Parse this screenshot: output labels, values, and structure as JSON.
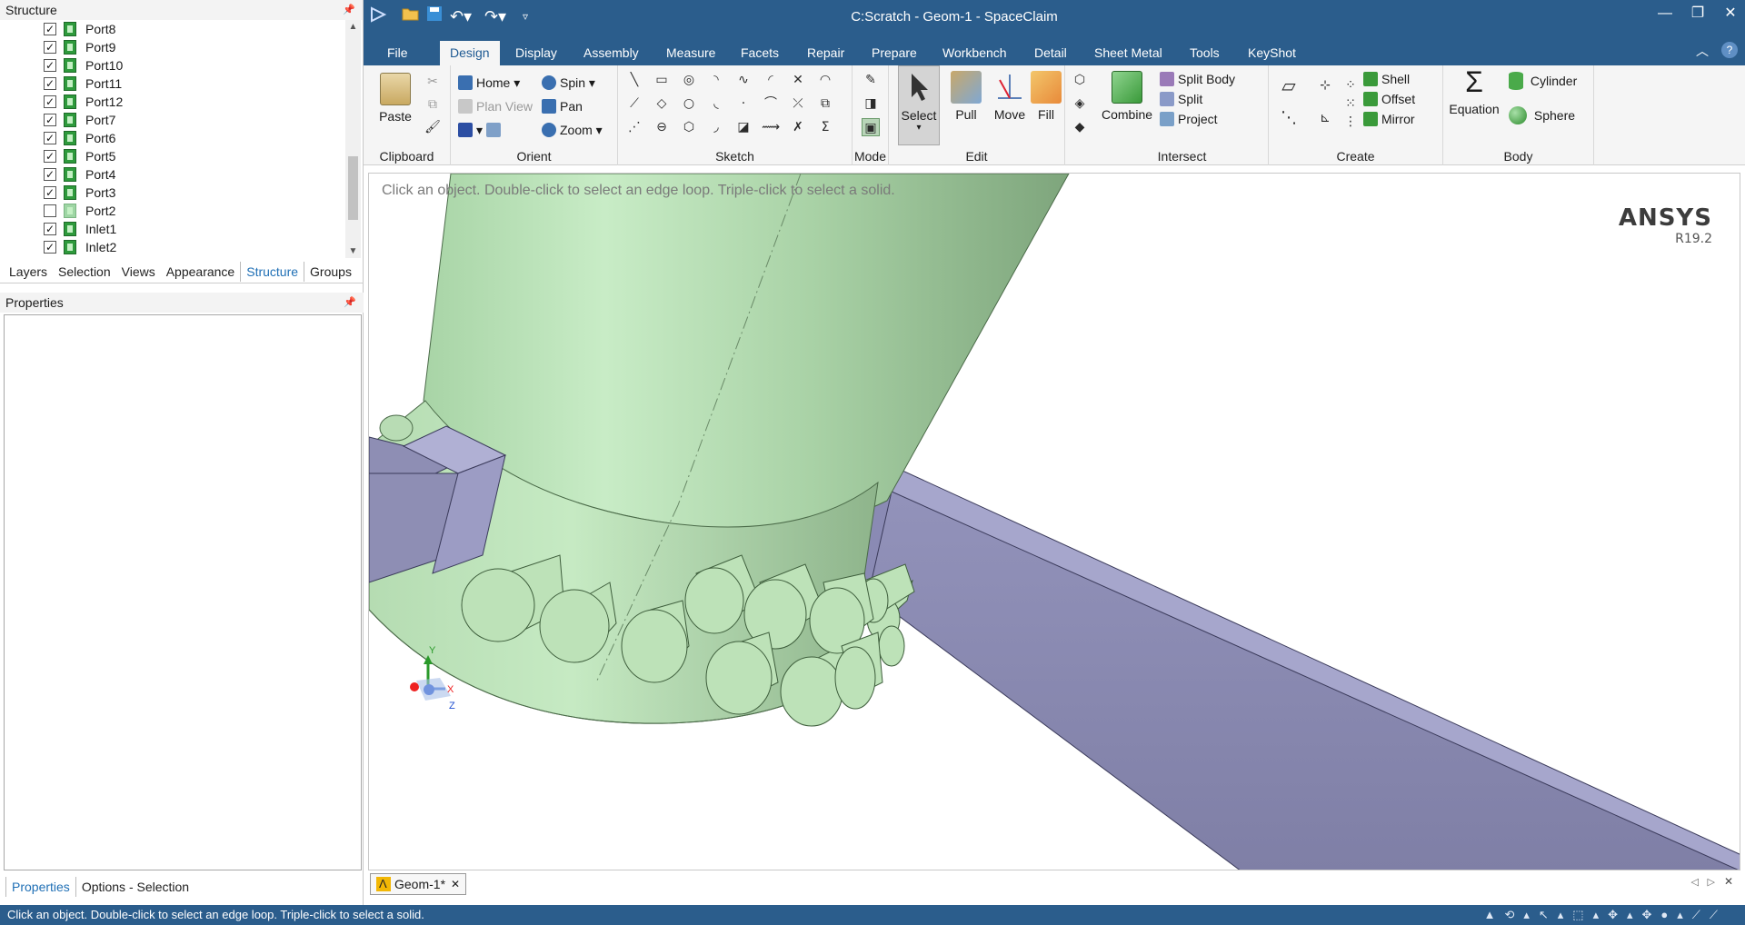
{
  "window": {
    "title": "C:Scratch - Geom-1 - SpaceClaim"
  },
  "structure": {
    "title": "Structure",
    "items": [
      {
        "label": "Port8",
        "checked": true
      },
      {
        "label": "Port9",
        "checked": true
      },
      {
        "label": "Port10",
        "checked": true
      },
      {
        "label": "Port11",
        "checked": true
      },
      {
        "label": "Port12",
        "checked": true
      },
      {
        "label": "Port7",
        "checked": true
      },
      {
        "label": "Port6",
        "checked": true
      },
      {
        "label": "Port5",
        "checked": true
      },
      {
        "label": "Port4",
        "checked": true
      },
      {
        "label": "Port3",
        "checked": true
      },
      {
        "label": "Port2",
        "checked": false
      },
      {
        "label": "Inlet1",
        "checked": true
      },
      {
        "label": "Inlet2",
        "checked": true
      }
    ]
  },
  "panel_tabs": [
    "Layers",
    "Selection",
    "Views",
    "Appearance",
    "Structure",
    "Groups"
  ],
  "properties": {
    "title": "Properties"
  },
  "bottom_tabs": [
    "Properties",
    "Options - Selection"
  ],
  "ribbon_tabs": [
    "File",
    "Design",
    "Display",
    "Assembly",
    "Measure",
    "Facets",
    "Repair",
    "Prepare",
    "Workbench",
    "Detail",
    "Sheet Metal",
    "Tools",
    "KeyShot"
  ],
  "ribbon": {
    "clipboard": {
      "label": "Clipboard",
      "paste": "Paste"
    },
    "orient": {
      "label": "Orient",
      "home": "Home",
      "plan_view": "Plan View",
      "spin": "Spin",
      "pan": "Pan",
      "zoom": "Zoom"
    },
    "sketch": {
      "label": "Sketch"
    },
    "mode": {
      "label": "Mode"
    },
    "edit": {
      "label": "Edit",
      "select": "Select",
      "pull": "Pull",
      "move": "Move",
      "fill": "Fill"
    },
    "intersect": {
      "label": "Intersect",
      "combine": "Combine",
      "split_body": "Split Body",
      "split": "Split",
      "project": "Project"
    },
    "create": {
      "label": "Create",
      "shell": "Shell",
      "offset": "Offset",
      "mirror": "Mirror"
    },
    "body": {
      "label": "Body",
      "equation": "Equation",
      "cylinder": "Cylinder",
      "sphere": "Sphere"
    }
  },
  "viewport": {
    "hint": "Click an object. Double-click to select an edge loop. Triple-click to select a solid.",
    "brand": "ANSYS",
    "version": "R19.2",
    "axes": {
      "y": "Y",
      "x": "X",
      "z": "Z"
    }
  },
  "doc_tab": {
    "label": "Geom-1*"
  },
  "status": {
    "text": "Click an object. Double-click to select an edge loop. Triple-click to select a solid."
  },
  "colors": {
    "title_bar": "#2b5d8c",
    "body_green": "#b8e0b4",
    "port_purple": "#8e8eb4"
  }
}
